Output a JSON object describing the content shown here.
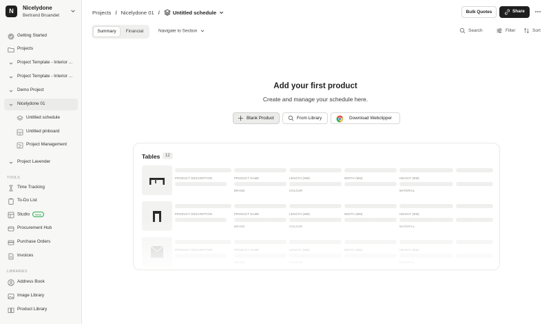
{
  "workspace": {
    "logo_letter": "N",
    "name": "Nicelydone",
    "user": "Bertrand Bruandet"
  },
  "sidebar": {
    "top_items": [
      {
        "label": "Getting Started",
        "icon": "check-circle-icon"
      },
      {
        "label": "Projects",
        "icon": "folder-icon"
      }
    ],
    "projects": [
      {
        "label": "Project Template - Interior ...",
        "icon": "chevron-down-icon"
      },
      {
        "label": "Project Template - Interior ...",
        "icon": "chevron-down-icon"
      },
      {
        "label": "Demo Project",
        "icon": "chevron-down-icon"
      },
      {
        "label": "Nicelydone 01",
        "icon": "chevron-down-icon",
        "active": true
      }
    ],
    "sub_items": [
      {
        "label": "Untitled schedule",
        "icon": "layers-icon"
      },
      {
        "label": "Untitled pinboard",
        "icon": "pinboard-icon"
      },
      {
        "label": "Project Management",
        "icon": "gantt-icon"
      }
    ],
    "lavender": {
      "label": "Project Lavender",
      "icon": "chevron-down-icon"
    },
    "tools_heading": "TOOLS",
    "tools": [
      {
        "label": "Time Tracking",
        "icon": "hourglass-icon"
      },
      {
        "label": "To-Do List",
        "icon": "clipboard-icon"
      },
      {
        "label": "Studio",
        "icon": "studio-icon",
        "badge": "New"
      },
      {
        "label": "Procurement Hub",
        "icon": "procurement-icon"
      },
      {
        "label": "Purchase Orders",
        "icon": "purchase-orders-icon"
      },
      {
        "label": "Invoices",
        "icon": "invoice-icon"
      }
    ],
    "libraries_heading": "LIBRARIES",
    "libraries": [
      {
        "label": "Address Book",
        "icon": "contacts-icon"
      },
      {
        "label": "Image Library",
        "icon": "image-icon"
      },
      {
        "label": "Product Library",
        "icon": "book-icon"
      }
    ]
  },
  "header": {
    "crumbs": [
      "Projects",
      "Nicelydone 01"
    ],
    "separator": "/",
    "current": "Untitled schedule",
    "bulk_quotes": "Bulk Quotes",
    "share": "Share"
  },
  "toolbar": {
    "tabs": [
      "Summary",
      "Financial"
    ],
    "selected_tab": "Summary",
    "navigate": "Navigate to Section",
    "search": "Search",
    "filter": "Filter",
    "sort": "Sort"
  },
  "empty_state": {
    "title": "Add your first product",
    "subtitle": "Create and manage your schedule here.",
    "actions": [
      "Blank Product",
      "From Library",
      "Download Webclipper"
    ]
  },
  "tables": {
    "title": "Tables",
    "count": "12",
    "columns_top": [
      "PRODUCT DESCRIPTION",
      "PRODUCT NAME",
      "LENGTH (MM)",
      "WIDTH (MM)",
      "HEIGHT (MM)"
    ],
    "columns_bottom": [
      "BRAND",
      "COLOUR",
      "MATERIAL"
    ]
  },
  "colors": {
    "accent_dark": "#1f1f1f",
    "badge_green": "#2da852",
    "sidebar_bg": "#f7f7f6"
  }
}
